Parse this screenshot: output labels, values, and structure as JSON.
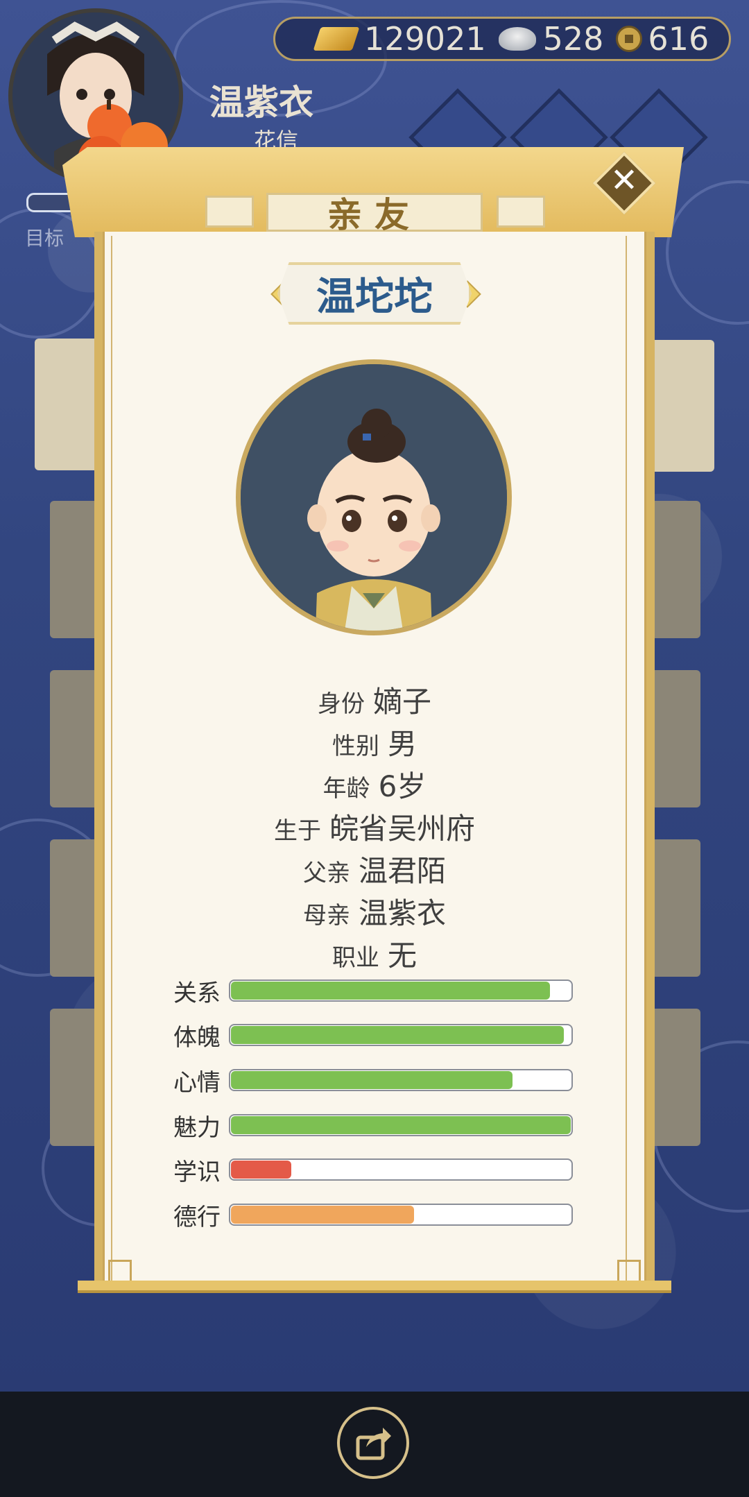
{
  "header": {
    "player_name": "温紫衣",
    "player_title": "花信",
    "goal_label": "目标",
    "currency": {
      "gold": "129021",
      "silver": "528",
      "coin": "616"
    }
  },
  "panel": {
    "tab_title": "亲友",
    "character_name": "温坨坨",
    "close_symbol": "✕",
    "info": [
      {
        "key": "身份",
        "value": "嫡子"
      },
      {
        "key": "性别",
        "value": "男"
      },
      {
        "key": "年龄",
        "value": "6岁"
      },
      {
        "key": "生于",
        "value": "皖省吴州府"
      },
      {
        "key": "父亲",
        "value": "温君陌"
      },
      {
        "key": "母亲",
        "value": "温紫衣"
      },
      {
        "key": "职业",
        "value": "无"
      }
    ],
    "stats": [
      {
        "label": "关系",
        "value": 0.94,
        "color": "#7dc052"
      },
      {
        "label": "体魄",
        "value": 0.98,
        "color": "#7dc052"
      },
      {
        "label": "心情",
        "value": 0.83,
        "color": "#7dc052"
      },
      {
        "label": "魅力",
        "value": 1.0,
        "color": "#7dc052"
      },
      {
        "label": "学识",
        "value": 0.18,
        "color": "#e45a48"
      },
      {
        "label": "德行",
        "value": 0.54,
        "color": "#f0a65c"
      }
    ]
  },
  "icons": {
    "share": "share-icon",
    "close": "close-icon",
    "gold": "gold-ingot-icon",
    "silver": "silver-ingot-icon",
    "coin": "copper-coin-icon"
  }
}
